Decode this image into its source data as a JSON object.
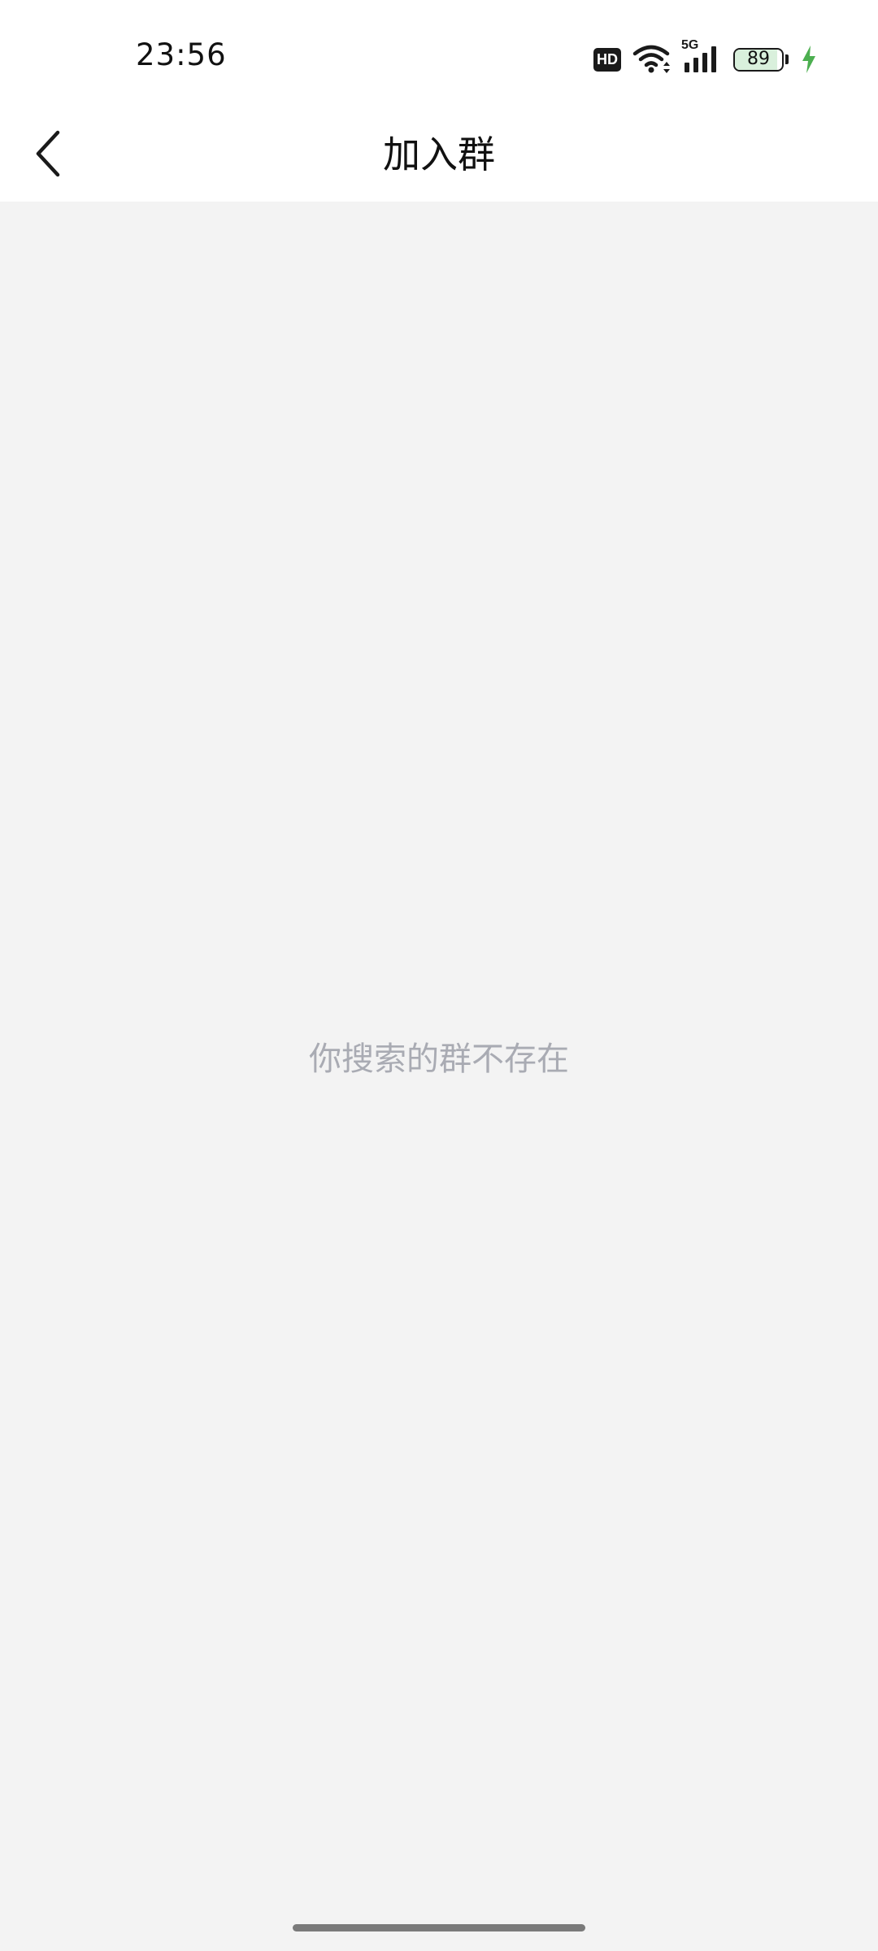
{
  "status_bar": {
    "time": "23:56",
    "hd_label": "HD",
    "network_label": "5G",
    "battery_level": "89",
    "battery_fraction": 0.89,
    "charging_color": "#4caf50"
  },
  "header": {
    "title": "加入群",
    "back_icon": "chevron-left-icon"
  },
  "main": {
    "empty_message": "你搜索的群不存在"
  },
  "colors": {
    "background": "#f3f3f3",
    "header_background": "#ffffff",
    "empty_text": "#a9abb3"
  }
}
